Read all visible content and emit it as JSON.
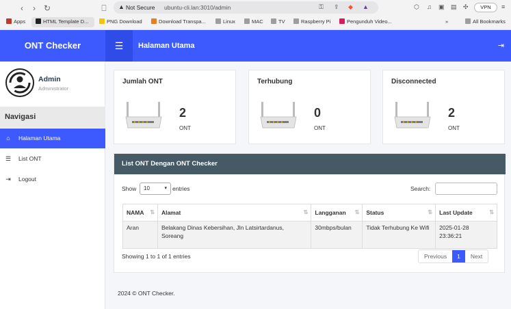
{
  "browser": {
    "security_label": "Not Secure",
    "url": "ubuntu-cli.lan:3010/admin",
    "vpn_label": "VPN",
    "bookmarks": [
      {
        "label": "Apps",
        "color": "#c0392b"
      },
      {
        "label": "HTML Template D...",
        "color": "#222222"
      },
      {
        "label": "PNG Download",
        "color": "#f1c40f"
      },
      {
        "label": "Download Transpa...",
        "color": "#e67e22"
      },
      {
        "label": "Linux",
        "color": "#9e9e9e"
      },
      {
        "label": "MAC",
        "color": "#9e9e9e"
      },
      {
        "label": "TV",
        "color": "#9e9e9e"
      },
      {
        "label": "Raspberry Pi",
        "color": "#9e9e9e"
      },
      {
        "label": "Pengunduh Video...",
        "color": "#d81b60"
      }
    ],
    "all_bookmarks_label": "All Bookmarks"
  },
  "app": {
    "brand": "ONT Checker",
    "page_title": "Halaman Utama"
  },
  "user": {
    "name": "Admin",
    "role": "Administrator"
  },
  "sidebar": {
    "heading": "Navigasi",
    "items": [
      {
        "label": "Halaman Utama",
        "icon": "home-icon",
        "active": true
      },
      {
        "label": "List ONT",
        "icon": "list-icon",
        "active": false
      },
      {
        "label": "Logout",
        "icon": "logout-icon",
        "active": false
      }
    ]
  },
  "cards": [
    {
      "title": "Jumlah ONT",
      "value": "2",
      "unit": "ONT"
    },
    {
      "title": "Terhubung",
      "value": "0",
      "unit": "ONT"
    },
    {
      "title": "Disconnected",
      "value": "2",
      "unit": "ONT"
    }
  ],
  "list": {
    "heading": "List ONT Dengan ONT Checker",
    "show_label": "Show",
    "page_size": "10",
    "entries_label": "entries",
    "search_label": "Search:",
    "columns": [
      "NAMA",
      "Alamat",
      "Langganan",
      "Status",
      "Last Update"
    ],
    "rows": [
      {
        "nama": "Aran",
        "alamat": "Belakang Dinas Kebersihan, Jln Latsirtardanus, Soreang",
        "langganan": "30mbps/bulan",
        "status": "Tidak Terhubung Ke Wifi",
        "last_update": "2025-01-28 23:36:21"
      }
    ],
    "info": "Showing 1 to 1 of 1 entries",
    "pagination": {
      "previous": "Previous",
      "current": "1",
      "next": "Next"
    }
  },
  "footer": "2024 © ONT Checker."
}
